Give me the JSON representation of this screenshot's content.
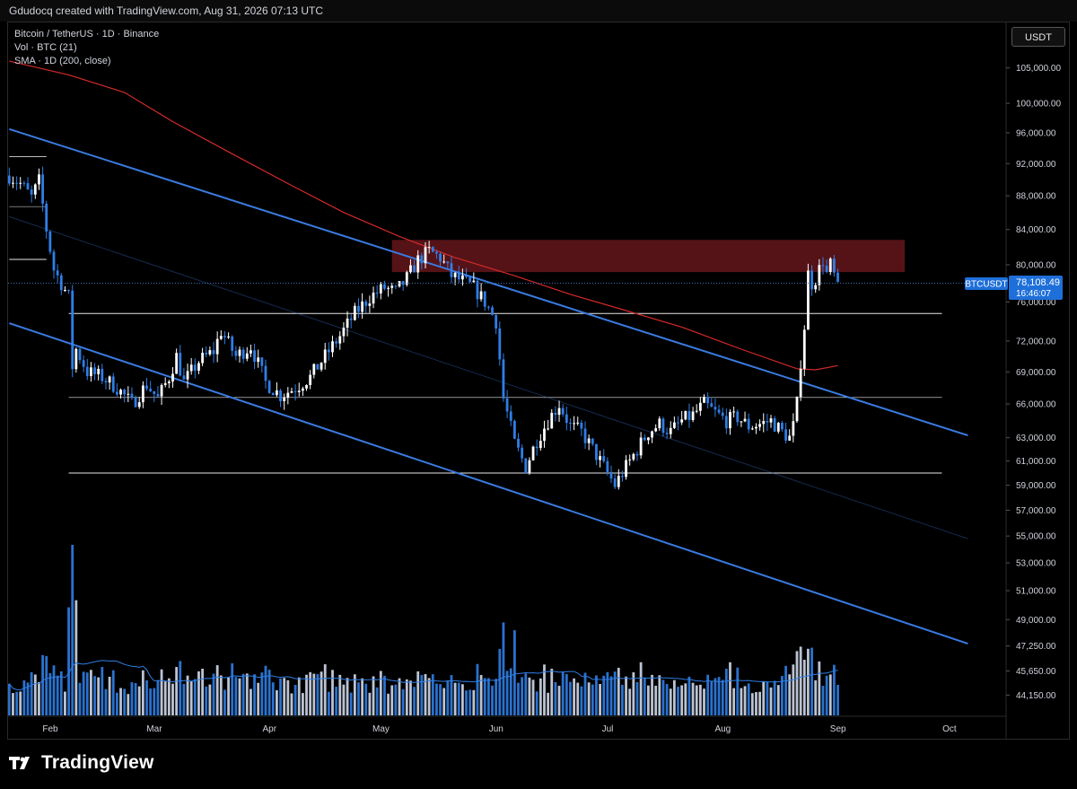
{
  "header": {
    "title": "Gdudocq created with TradingView.com, Aug 31, 2026 07:13 UTC"
  },
  "legend": {
    "symbol": "Bitcoin / TetherUS · 1D · Binance",
    "volume": "Vol · BTC (21)",
    "sma": "SMA · 1D (200, close)"
  },
  "currency_button": "USDT",
  "price_label": {
    "symbol": "BTCUSDT",
    "price": "78,108.49",
    "countdown": "16:46:07",
    "value": 78108.49
  },
  "brand": {
    "name": "TradingView"
  },
  "colors": {
    "background": "#000000",
    "up": "#ffffff",
    "down": "#2f7ee6",
    "channel": "#3a7be0",
    "sma": "#d42a2a",
    "resistance_zone": "#5a1418",
    "accent": "#1e6fd9"
  },
  "chart_data": {
    "type": "candlestick",
    "title": "Bitcoin / TetherUS · 1D · Binance",
    "x_axis": {
      "ticks": [
        "Feb",
        "Mar",
        "Apr",
        "May",
        "Jun",
        "Jul",
        "Aug",
        "Sep",
        "Oct"
      ]
    },
    "y_axis": {
      "scale": "log",
      "range": [
        45000,
        108000
      ],
      "ticks": [
        "105,000.00",
        "100,000.00",
        "96,000.00",
        "92,000.00",
        "88,000.00",
        "84,000.00",
        "80,000.00",
        "76,000.00",
        "72,000.00",
        "69,000.00",
        "66,000.00",
        "63,000.00",
        "61,000.00",
        "59,000.00",
        "57,000.00",
        "55,000.00",
        "53,000.00",
        "51,000.00",
        "49,000.00",
        "47,250.00",
        "45,650.00",
        "44,150.00"
      ]
    },
    "price_path": [
      [
        "2026-01-20",
        90500
      ],
      [
        "2026-01-23",
        89500
      ],
      [
        "2026-01-26",
        87800
      ],
      [
        "2026-01-28",
        89800
      ],
      [
        "2026-01-30",
        84000
      ],
      [
        "2026-02-01",
        79500
      ],
      [
        "2026-02-03",
        78000
      ],
      [
        "2026-02-05",
        76500
      ],
      [
        "2026-02-06",
        69500
      ],
      [
        "2026-02-07",
        71200
      ],
      [
        "2026-02-10",
        69000
      ],
      [
        "2026-02-14",
        68500
      ],
      [
        "2026-02-18",
        67500
      ],
      [
        "2026-02-22",
        66000
      ],
      [
        "2026-02-26",
        67800
      ],
      [
        "2026-03-01",
        66500
      ],
      [
        "2026-03-04",
        68500
      ],
      [
        "2026-03-06",
        70500
      ],
      [
        "2026-03-08",
        68000
      ],
      [
        "2026-03-12",
        70000
      ],
      [
        "2026-03-16",
        71000
      ],
      [
        "2026-03-18",
        73000
      ],
      [
        "2026-03-22",
        70500
      ],
      [
        "2026-03-26",
        71500
      ],
      [
        "2026-03-30",
        68000
      ],
      [
        "2026-04-03",
        66800
      ],
      [
        "2026-04-07",
        67500
      ],
      [
        "2026-04-11",
        68500
      ],
      [
        "2026-04-15",
        70500
      ],
      [
        "2026-04-19",
        72500
      ],
      [
        "2026-04-23",
        74800
      ],
      [
        "2026-04-27",
        76500
      ],
      [
        "2026-05-01",
        77500
      ],
      [
        "2026-05-04",
        77000
      ],
      [
        "2026-05-07",
        78500
      ],
      [
        "2026-05-10",
        80500
      ],
      [
        "2026-05-13",
        81500
      ],
      [
        "2026-05-16",
        80800
      ],
      [
        "2026-05-19",
        78800
      ],
      [
        "2026-05-22",
        78200
      ],
      [
        "2026-05-25",
        77500
      ],
      [
        "2026-05-28",
        76000
      ],
      [
        "2026-05-31",
        74000
      ],
      [
        "2026-06-02",
        66500
      ],
      [
        "2026-06-05",
        62500
      ],
      [
        "2026-06-08",
        60500
      ],
      [
        "2026-06-11",
        62800
      ],
      [
        "2026-06-14",
        64500
      ],
      [
        "2026-06-17",
        66000
      ],
      [
        "2026-06-20",
        64000
      ],
      [
        "2026-06-23",
        63500
      ],
      [
        "2026-06-26",
        62000
      ],
      [
        "2026-06-29",
        60500
      ],
      [
        "2026-07-02",
        59000
      ],
      [
        "2026-07-05",
        60500
      ],
      [
        "2026-07-08",
        62000
      ],
      [
        "2026-07-11",
        63500
      ],
      [
        "2026-07-14",
        64200
      ],
      [
        "2026-07-17",
        63500
      ],
      [
        "2026-07-20",
        64500
      ],
      [
        "2026-07-23",
        65000
      ],
      [
        "2026-07-26",
        66000
      ],
      [
        "2026-07-29",
        65200
      ],
      [
        "2026-08-01",
        64500
      ],
      [
        "2026-08-04",
        64800
      ],
      [
        "2026-08-07",
        64000
      ],
      [
        "2026-08-10",
        64200
      ],
      [
        "2026-08-13",
        64500
      ],
      [
        "2026-08-16",
        63500
      ],
      [
        "2026-08-18",
        63000
      ],
      [
        "2026-08-19",
        64000
      ],
      [
        "2026-08-20",
        66000
      ],
      [
        "2026-08-21",
        70000
      ],
      [
        "2026-08-22",
        73500
      ],
      [
        "2026-08-23",
        79000
      ],
      [
        "2026-08-24",
        78000
      ],
      [
        "2026-08-25",
        78500
      ],
      [
        "2026-08-26",
        79500
      ],
      [
        "2026-08-27",
        80500
      ],
      [
        "2026-08-28",
        79000
      ],
      [
        "2026-08-29",
        80000
      ],
      [
        "2026-08-30",
        78800
      ],
      [
        "2026-08-31",
        78108.49
      ]
    ],
    "sma_200": [
      [
        "2026-01-20",
        106000
      ],
      [
        "2026-02-05",
        104000
      ],
      [
        "2026-02-20",
        101500
      ],
      [
        "2026-03-05",
        97500
      ],
      [
        "2026-03-20",
        93500
      ],
      [
        "2026-04-05",
        89500
      ],
      [
        "2026-04-20",
        86000
      ],
      [
        "2026-05-05",
        83200
      ],
      [
        "2026-05-20",
        80800
      ],
      [
        "2026-06-05",
        78800
      ],
      [
        "2026-06-20",
        76800
      ],
      [
        "2026-07-05",
        75100
      ],
      [
        "2026-07-20",
        73400
      ],
      [
        "2026-08-05",
        71200
      ],
      [
        "2026-08-20",
        69300
      ],
      [
        "2026-08-25",
        69200
      ],
      [
        "2026-08-31",
        69600
      ]
    ],
    "annotations": {
      "descending_channel_upper": [
        [
          "2026-01-20",
          96500
        ],
        [
          "2026-10-05",
          63200
        ]
      ],
      "descending_channel_lower": [
        [
          "2026-01-20",
          73800
        ],
        [
          "2026-10-05",
          47400
        ]
      ],
      "descending_channel_mid": [
        [
          "2026-01-20",
          85500
        ],
        [
          "2026-10-05",
          54800
        ]
      ],
      "resistance_zone": {
        "from": "2026-05-03",
        "to": "2026-09-18",
        "low": 79200,
        "high": 82800
      },
      "horizontal_levels": [
        {
          "from": "2026-01-20",
          "to": "2026-01-30",
          "price": 92900
        },
        {
          "from": "2026-01-20",
          "to": "2026-01-30",
          "price": 86700
        },
        {
          "from": "2026-01-20",
          "to": "2026-01-30",
          "price": 80600
        },
        {
          "from": "2026-02-05",
          "to": "2026-09-28",
          "price": 74800
        },
        {
          "from": "2026-02-05",
          "to": "2026-09-28",
          "price": 66600
        },
        {
          "from": "2026-02-05",
          "to": "2026-09-28",
          "price": 60000
        }
      ]
    },
    "volume_sma_length": 21
  }
}
